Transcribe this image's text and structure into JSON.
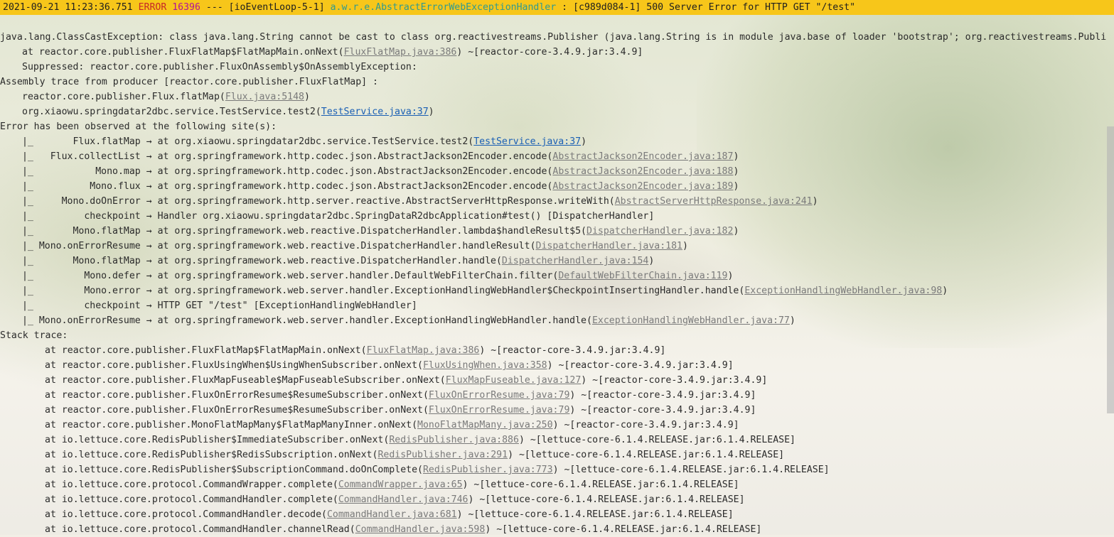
{
  "header": {
    "timestamp": "2021-09-21 11:23:36.751",
    "level": "ERROR",
    "pid": "16396",
    "separator": "---",
    "thread": "[ioEventLoop-5-1]",
    "logger": "a.w.r.e.AbstractErrorWebExceptionHandler",
    "colon": ":",
    "request_id": "[c989d084-1]",
    "message": "500 Server Error for HTTP GET \"/test\""
  },
  "exception_line": "java.lang.ClassCastException: class java.lang.String cannot be cast to class org.reactivestreams.Publisher (java.lang.String is in module java.base of loader 'bootstrap'; org.reactivestreams.Publi",
  "first_frame": {
    "prefix": "at reactor.core.publisher.FluxFlatMap$FlatMapMain.onNext(",
    "link": "FluxFlatMap.java:386",
    "suffix": ") ~[reactor-core-3.4.9.jar:3.4.9]"
  },
  "suppressed_line": "Suppressed: reactor.core.publisher.FluxOnAssembly$OnAssemblyException:",
  "assembly_line": "Assembly trace from producer [reactor.core.publisher.FluxFlatMap] :",
  "assembly_frames": [
    {
      "prefix": "reactor.core.publisher.Flux.flatMap(",
      "link": "Flux.java:5148",
      "suffix": ")",
      "style": "gray"
    },
    {
      "prefix": "org.xiaowu.springdatar2dbc.service.TestService.test2(",
      "link": "TestService.java:37",
      "suffix": ")",
      "style": "blue"
    }
  ],
  "observed_line": "Error has been observed at the following site(s):",
  "observed_sites": [
    {
      "op": "|_       Flux.flatMap",
      "text": "at org.xiaowu.springdatar2dbc.service.TestService.test2(",
      "link": "TestService.java:37",
      "suffix": ")",
      "style": "blue"
    },
    {
      "op": "|_   Flux.collectList",
      "text": "at org.springframework.http.codec.json.AbstractJackson2Encoder.encode(",
      "link": "AbstractJackson2Encoder.java:187",
      "suffix": ")",
      "style": "gray"
    },
    {
      "op": "|_           Mono.map",
      "text": "at org.springframework.http.codec.json.AbstractJackson2Encoder.encode(",
      "link": "AbstractJackson2Encoder.java:188",
      "suffix": ")",
      "style": "gray"
    },
    {
      "op": "|_          Mono.flux",
      "text": "at org.springframework.http.codec.json.AbstractJackson2Encoder.encode(",
      "link": "AbstractJackson2Encoder.java:189",
      "suffix": ")",
      "style": "gray"
    },
    {
      "op": "|_     Mono.doOnError",
      "text": "at org.springframework.http.server.reactive.AbstractServerHttpResponse.writeWith(",
      "link": "AbstractServerHttpResponse.java:241",
      "suffix": ")",
      "style": "gray"
    },
    {
      "op": "|_         checkpoint",
      "text": "Handler org.xiaowu.springdatar2dbc.SpringDataR2dbcApplication#test() [DispatcherHandler]",
      "link": "",
      "suffix": "",
      "style": "none"
    },
    {
      "op": "|_       Mono.flatMap",
      "text": "at org.springframework.web.reactive.DispatcherHandler.lambda$handleResult$5(",
      "link": "DispatcherHandler.java:182",
      "suffix": ")",
      "style": "gray"
    },
    {
      "op": "|_ Mono.onErrorResume",
      "text": "at org.springframework.web.reactive.DispatcherHandler.handleResult(",
      "link": "DispatcherHandler.java:181",
      "suffix": ")",
      "style": "gray"
    },
    {
      "op": "|_       Mono.flatMap",
      "text": "at org.springframework.web.reactive.DispatcherHandler.handle(",
      "link": "DispatcherHandler.java:154",
      "suffix": ")",
      "style": "gray"
    },
    {
      "op": "|_         Mono.defer",
      "text": "at org.springframework.web.server.handler.DefaultWebFilterChain.filter(",
      "link": "DefaultWebFilterChain.java:119",
      "suffix": ")",
      "style": "gray"
    },
    {
      "op": "|_         Mono.error",
      "text": "at org.springframework.web.server.handler.ExceptionHandlingWebHandler$CheckpointInsertingHandler.handle(",
      "link": "ExceptionHandlingWebHandler.java:98",
      "suffix": ")",
      "style": "gray"
    },
    {
      "op": "|_         checkpoint",
      "text": "HTTP GET \"/test\" [ExceptionHandlingWebHandler]",
      "link": "",
      "suffix": "",
      "style": "none"
    },
    {
      "op": "|_ Mono.onErrorResume",
      "text": "at org.springframework.web.server.handler.ExceptionHandlingWebHandler.handle(",
      "link": "ExceptionHandlingWebHandler.java:77",
      "suffix": ")",
      "style": "gray"
    }
  ],
  "arrow": "→",
  "stack_label": "Stack trace:",
  "stack_frames": [
    {
      "prefix": "at reactor.core.publisher.FluxFlatMap$FlatMapMain.onNext(",
      "link": "FluxFlatMap.java:386",
      "suffix": ") ~[reactor-core-3.4.9.jar:3.4.9]"
    },
    {
      "prefix": "at reactor.core.publisher.FluxUsingWhen$UsingWhenSubscriber.onNext(",
      "link": "FluxUsingWhen.java:358",
      "suffix": ") ~[reactor-core-3.4.9.jar:3.4.9]"
    },
    {
      "prefix": "at reactor.core.publisher.FluxMapFuseable$MapFuseableSubscriber.onNext(",
      "link": "FluxMapFuseable.java:127",
      "suffix": ") ~[reactor-core-3.4.9.jar:3.4.9]"
    },
    {
      "prefix": "at reactor.core.publisher.FluxOnErrorResume$ResumeSubscriber.onNext(",
      "link": "FluxOnErrorResume.java:79",
      "suffix": ") ~[reactor-core-3.4.9.jar:3.4.9]"
    },
    {
      "prefix": "at reactor.core.publisher.FluxOnErrorResume$ResumeSubscriber.onNext(",
      "link": "FluxOnErrorResume.java:79",
      "suffix": ") ~[reactor-core-3.4.9.jar:3.4.9]"
    },
    {
      "prefix": "at reactor.core.publisher.MonoFlatMapMany$FlatMapManyInner.onNext(",
      "link": "MonoFlatMapMany.java:250",
      "suffix": ") ~[reactor-core-3.4.9.jar:3.4.9]"
    },
    {
      "prefix": "at io.lettuce.core.RedisPublisher$ImmediateSubscriber.onNext(",
      "link": "RedisPublisher.java:886",
      "suffix": ") ~[lettuce-core-6.1.4.RELEASE.jar:6.1.4.RELEASE]"
    },
    {
      "prefix": "at io.lettuce.core.RedisPublisher$RedisSubscription.onNext(",
      "link": "RedisPublisher.java:291",
      "suffix": ") ~[lettuce-core-6.1.4.RELEASE.jar:6.1.4.RELEASE]"
    },
    {
      "prefix": "at io.lettuce.core.RedisPublisher$SubscriptionCommand.doOnComplete(",
      "link": "RedisPublisher.java:773",
      "suffix": ") ~[lettuce-core-6.1.4.RELEASE.jar:6.1.4.RELEASE]"
    },
    {
      "prefix": "at io.lettuce.core.protocol.CommandWrapper.complete(",
      "link": "CommandWrapper.java:65",
      "suffix": ") ~[lettuce-core-6.1.4.RELEASE.jar:6.1.4.RELEASE]"
    },
    {
      "prefix": "at io.lettuce.core.protocol.CommandHandler.complete(",
      "link": "CommandHandler.java:746",
      "suffix": ") ~[lettuce-core-6.1.4.RELEASE.jar:6.1.4.RELEASE]"
    },
    {
      "prefix": "at io.lettuce.core.protocol.CommandHandler.decode(",
      "link": "CommandHandler.java:681",
      "suffix": ") ~[lettuce-core-6.1.4.RELEASE.jar:6.1.4.RELEASE]"
    },
    {
      "prefix": "at io.lettuce.core.protocol.CommandHandler.channelRead(",
      "link": "CommandHandler.java:598",
      "suffix": ") ~[lettuce-core-6.1.4.RELEASE.jar:6.1.4.RELEASE]"
    }
  ],
  "colors": {
    "header_bg": "#f7c61a",
    "error_level": "#c62828",
    "pid": "#b1149a",
    "logger": "#2f9a92",
    "link_blue": "#1a5fb4",
    "link_gray": "#7a7a7a",
    "text": "#2b2b2b"
  }
}
